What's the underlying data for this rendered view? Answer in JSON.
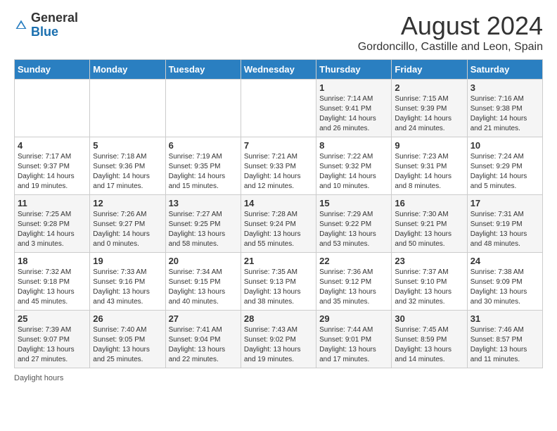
{
  "header": {
    "logo_general": "General",
    "logo_blue": "Blue",
    "month_title": "August 2024",
    "subtitle": "Gordoncillo, Castille and Leon, Spain"
  },
  "columns": [
    "Sunday",
    "Monday",
    "Tuesday",
    "Wednesday",
    "Thursday",
    "Friday",
    "Saturday"
  ],
  "weeks": [
    [
      {
        "day": "",
        "sunrise": "",
        "sunset": "",
        "daylight": ""
      },
      {
        "day": "",
        "sunrise": "",
        "sunset": "",
        "daylight": ""
      },
      {
        "day": "",
        "sunrise": "",
        "sunset": "",
        "daylight": ""
      },
      {
        "day": "",
        "sunrise": "",
        "sunset": "",
        "daylight": ""
      },
      {
        "day": "1",
        "sunrise": "Sunrise: 7:14 AM",
        "sunset": "Sunset: 9:41 PM",
        "daylight": "Daylight: 14 hours and 26 minutes."
      },
      {
        "day": "2",
        "sunrise": "Sunrise: 7:15 AM",
        "sunset": "Sunset: 9:39 PM",
        "daylight": "Daylight: 14 hours and 24 minutes."
      },
      {
        "day": "3",
        "sunrise": "Sunrise: 7:16 AM",
        "sunset": "Sunset: 9:38 PM",
        "daylight": "Daylight: 14 hours and 21 minutes."
      }
    ],
    [
      {
        "day": "4",
        "sunrise": "Sunrise: 7:17 AM",
        "sunset": "Sunset: 9:37 PM",
        "daylight": "Daylight: 14 hours and 19 minutes."
      },
      {
        "day": "5",
        "sunrise": "Sunrise: 7:18 AM",
        "sunset": "Sunset: 9:36 PM",
        "daylight": "Daylight: 14 hours and 17 minutes."
      },
      {
        "day": "6",
        "sunrise": "Sunrise: 7:19 AM",
        "sunset": "Sunset: 9:35 PM",
        "daylight": "Daylight: 14 hours and 15 minutes."
      },
      {
        "day": "7",
        "sunrise": "Sunrise: 7:21 AM",
        "sunset": "Sunset: 9:33 PM",
        "daylight": "Daylight: 14 hours and 12 minutes."
      },
      {
        "day": "8",
        "sunrise": "Sunrise: 7:22 AM",
        "sunset": "Sunset: 9:32 PM",
        "daylight": "Daylight: 14 hours and 10 minutes."
      },
      {
        "day": "9",
        "sunrise": "Sunrise: 7:23 AM",
        "sunset": "Sunset: 9:31 PM",
        "daylight": "Daylight: 14 hours and 8 minutes."
      },
      {
        "day": "10",
        "sunrise": "Sunrise: 7:24 AM",
        "sunset": "Sunset: 9:29 PM",
        "daylight": "Daylight: 14 hours and 5 minutes."
      }
    ],
    [
      {
        "day": "11",
        "sunrise": "Sunrise: 7:25 AM",
        "sunset": "Sunset: 9:28 PM",
        "daylight": "Daylight: 14 hours and 3 minutes."
      },
      {
        "day": "12",
        "sunrise": "Sunrise: 7:26 AM",
        "sunset": "Sunset: 9:27 PM",
        "daylight": "Daylight: 14 hours and 0 minutes."
      },
      {
        "day": "13",
        "sunrise": "Sunrise: 7:27 AM",
        "sunset": "Sunset: 9:25 PM",
        "daylight": "Daylight: 13 hours and 58 minutes."
      },
      {
        "day": "14",
        "sunrise": "Sunrise: 7:28 AM",
        "sunset": "Sunset: 9:24 PM",
        "daylight": "Daylight: 13 hours and 55 minutes."
      },
      {
        "day": "15",
        "sunrise": "Sunrise: 7:29 AM",
        "sunset": "Sunset: 9:22 PM",
        "daylight": "Daylight: 13 hours and 53 minutes."
      },
      {
        "day": "16",
        "sunrise": "Sunrise: 7:30 AM",
        "sunset": "Sunset: 9:21 PM",
        "daylight": "Daylight: 13 hours and 50 minutes."
      },
      {
        "day": "17",
        "sunrise": "Sunrise: 7:31 AM",
        "sunset": "Sunset: 9:19 PM",
        "daylight": "Daylight: 13 hours and 48 minutes."
      }
    ],
    [
      {
        "day": "18",
        "sunrise": "Sunrise: 7:32 AM",
        "sunset": "Sunset: 9:18 PM",
        "daylight": "Daylight: 13 hours and 45 minutes."
      },
      {
        "day": "19",
        "sunrise": "Sunrise: 7:33 AM",
        "sunset": "Sunset: 9:16 PM",
        "daylight": "Daylight: 13 hours and 43 minutes."
      },
      {
        "day": "20",
        "sunrise": "Sunrise: 7:34 AM",
        "sunset": "Sunset: 9:15 PM",
        "daylight": "Daylight: 13 hours and 40 minutes."
      },
      {
        "day": "21",
        "sunrise": "Sunrise: 7:35 AM",
        "sunset": "Sunset: 9:13 PM",
        "daylight": "Daylight: 13 hours and 38 minutes."
      },
      {
        "day": "22",
        "sunrise": "Sunrise: 7:36 AM",
        "sunset": "Sunset: 9:12 PM",
        "daylight": "Daylight: 13 hours and 35 minutes."
      },
      {
        "day": "23",
        "sunrise": "Sunrise: 7:37 AM",
        "sunset": "Sunset: 9:10 PM",
        "daylight": "Daylight: 13 hours and 32 minutes."
      },
      {
        "day": "24",
        "sunrise": "Sunrise: 7:38 AM",
        "sunset": "Sunset: 9:09 PM",
        "daylight": "Daylight: 13 hours and 30 minutes."
      }
    ],
    [
      {
        "day": "25",
        "sunrise": "Sunrise: 7:39 AM",
        "sunset": "Sunset: 9:07 PM",
        "daylight": "Daylight: 13 hours and 27 minutes."
      },
      {
        "day": "26",
        "sunrise": "Sunrise: 7:40 AM",
        "sunset": "Sunset: 9:05 PM",
        "daylight": "Daylight: 13 hours and 25 minutes."
      },
      {
        "day": "27",
        "sunrise": "Sunrise: 7:41 AM",
        "sunset": "Sunset: 9:04 PM",
        "daylight": "Daylight: 13 hours and 22 minutes."
      },
      {
        "day": "28",
        "sunrise": "Sunrise: 7:43 AM",
        "sunset": "Sunset: 9:02 PM",
        "daylight": "Daylight: 13 hours and 19 minutes."
      },
      {
        "day": "29",
        "sunrise": "Sunrise: 7:44 AM",
        "sunset": "Sunset: 9:01 PM",
        "daylight": "Daylight: 13 hours and 17 minutes."
      },
      {
        "day": "30",
        "sunrise": "Sunrise: 7:45 AM",
        "sunset": "Sunset: 8:59 PM",
        "daylight": "Daylight: 13 hours and 14 minutes."
      },
      {
        "day": "31",
        "sunrise": "Sunrise: 7:46 AM",
        "sunset": "Sunset: 8:57 PM",
        "daylight": "Daylight: 13 hours and 11 minutes."
      }
    ]
  ],
  "footer": {
    "note": "Daylight hours"
  }
}
